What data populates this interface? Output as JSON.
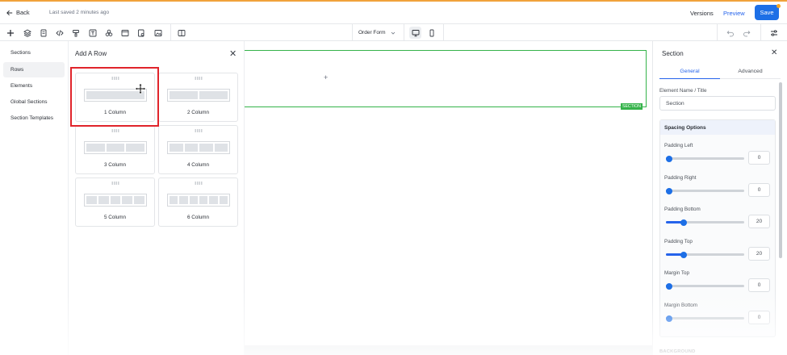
{
  "header": {
    "back_label": "Back",
    "last_saved": "Last saved 2 minutes ago",
    "versions_label": "Versions",
    "preview_label": "Preview",
    "save_label": "Save"
  },
  "toolbar": {
    "form_select": "Order Form"
  },
  "left_nav": {
    "items": [
      {
        "label": "Sections"
      },
      {
        "label": "Rows",
        "active": true
      },
      {
        "label": "Elements"
      },
      {
        "label": "Global Sections"
      },
      {
        "label": "Section Templates"
      }
    ]
  },
  "rows_panel": {
    "title": "Add A Row",
    "cards": [
      {
        "label": "1 Column",
        "columns": 1
      },
      {
        "label": "2 Column",
        "columns": 2
      },
      {
        "label": "3 Column",
        "columns": 3
      },
      {
        "label": "4 Column",
        "columns": 4
      },
      {
        "label": "5 Column",
        "columns": 5
      },
      {
        "label": "6 Column",
        "columns": 6
      }
    ]
  },
  "canvas": {
    "section_tag": "SECTION",
    "plus": "+"
  },
  "right_panel": {
    "title": "Section",
    "tabs": [
      {
        "label": "General",
        "active": true
      },
      {
        "label": "Advanced"
      }
    ],
    "name_label": "Element Name / Title",
    "name_value": "Section",
    "spacing_title": "Spacing Options",
    "spacing": [
      {
        "label": "Padding Left",
        "value": "0",
        "fraction": 0.0
      },
      {
        "label": "Padding Right",
        "value": "0",
        "fraction": 0.0
      },
      {
        "label": "Padding Bottom",
        "value": "20",
        "fraction": 0.2
      },
      {
        "label": "Padding Top",
        "value": "20",
        "fraction": 0.2
      },
      {
        "label": "Margin Top",
        "value": "0",
        "fraction": 0.0
      },
      {
        "label": "Margin Bottom",
        "value": "0",
        "fraction": 0.0
      }
    ],
    "background_label": "BACKGROUND"
  },
  "colors": {
    "accent": "#1d6fe6",
    "section_outline": "#35b34a",
    "highlight": "#e0242b"
  }
}
